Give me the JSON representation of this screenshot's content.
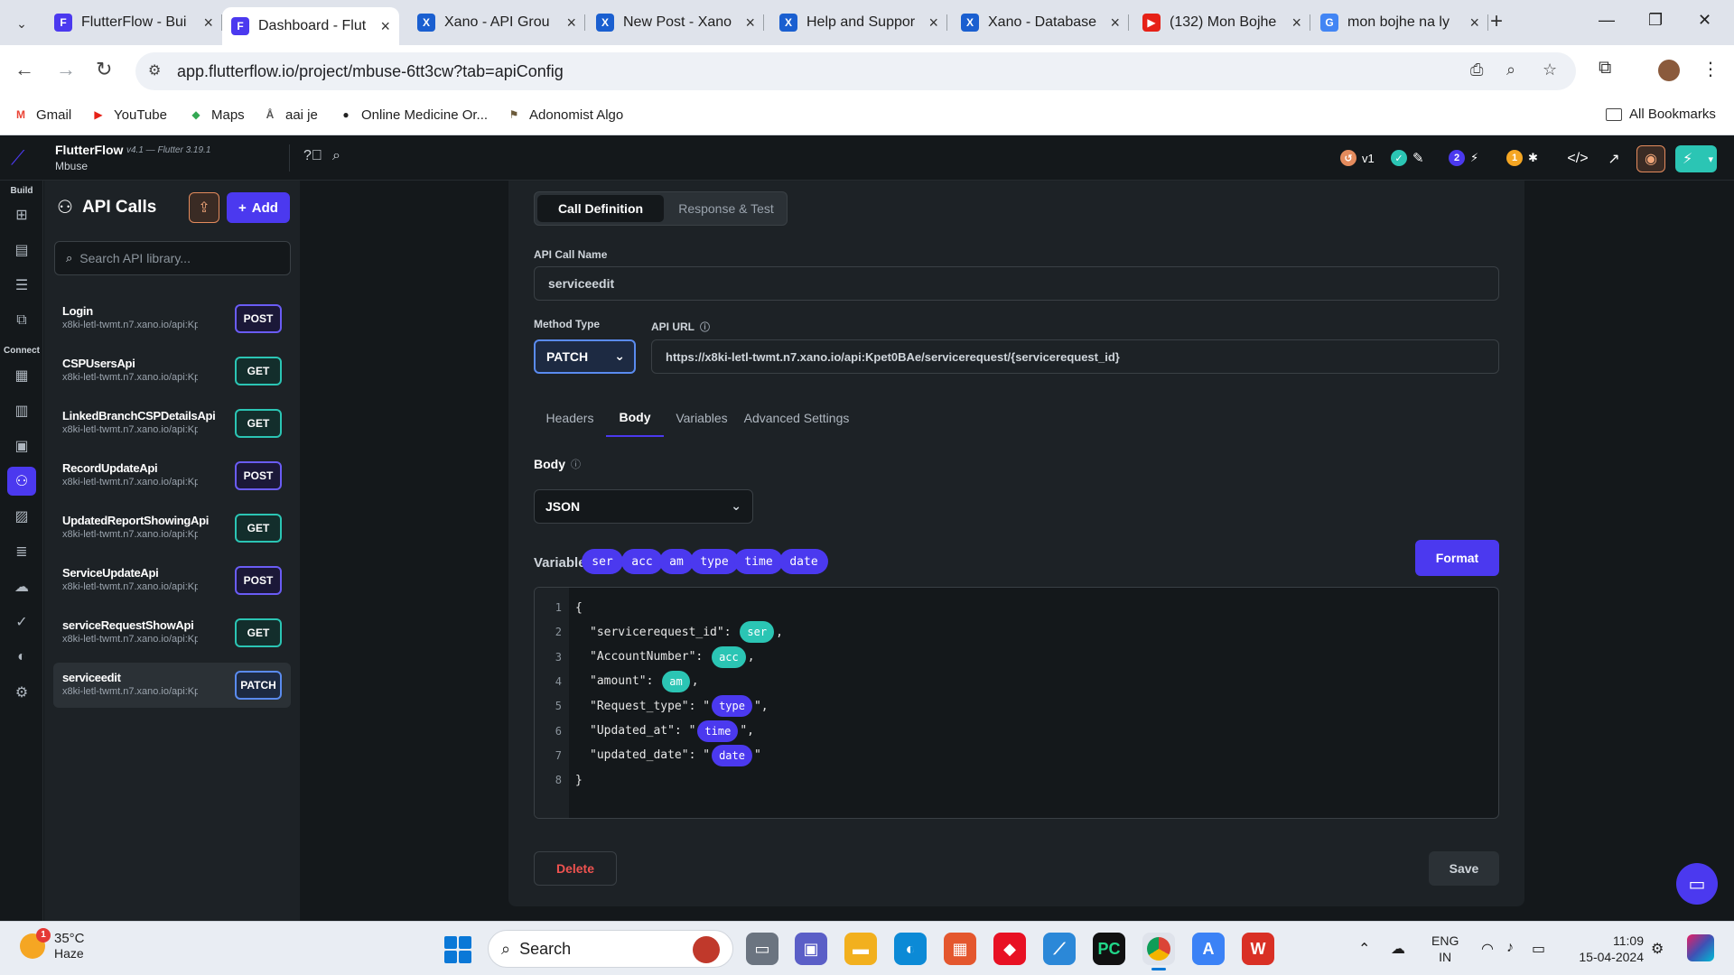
{
  "browser": {
    "tabs": [
      {
        "title": "FlutterFlow - Bui",
        "favicon": "flutterflow-icon",
        "color": "#4b39ef",
        "glyph": "F"
      },
      {
        "title": "Dashboard - Flut",
        "favicon": "flutterflow-icon",
        "color": "#4b39ef",
        "glyph": "F",
        "active": true
      },
      {
        "title": "Xano - API Grou",
        "favicon": "xano-icon",
        "color": "#1a5fd0",
        "glyph": "X"
      },
      {
        "title": "New Post - Xano",
        "favicon": "xano-icon",
        "color": "#1a5fd0",
        "glyph": "X"
      },
      {
        "title": "Help and Suppor",
        "favicon": "xano-icon",
        "color": "#1a5fd0",
        "glyph": "X"
      },
      {
        "title": "Xano - Database",
        "favicon": "xano-icon",
        "color": "#1a5fd0",
        "glyph": "X"
      },
      {
        "title": "(132) Mon Bojhe",
        "favicon": "youtube-icon",
        "color": "#e62117",
        "glyph": "▶"
      },
      {
        "title": "mon bojhe na ly",
        "favicon": "google-icon",
        "color": "#4285f4",
        "glyph": "G"
      }
    ],
    "url": "app.flutterflow.io/project/mbuse-6tt3cw?tab=apiConfig",
    "bookmarks": [
      {
        "label": "Gmail",
        "icon": "gmail-icon",
        "color": "#ea4335",
        "glyph": "M"
      },
      {
        "label": "YouTube",
        "icon": "youtube-icon",
        "color": "#e62117",
        "glyph": "▶"
      },
      {
        "label": "Maps",
        "icon": "maps-icon",
        "color": "#34a853",
        "glyph": "◆"
      },
      {
        "label": "aai je",
        "icon": "site-icon",
        "color": "#555555",
        "glyph": "Å"
      },
      {
        "label": "Online Medicine Or...",
        "icon": "globe-icon",
        "color": "#222222",
        "glyph": "●"
      },
      {
        "label": "Adonomist Algo",
        "icon": "site-icon",
        "color": "#6b5a3a",
        "glyph": "⚑"
      }
    ],
    "all_bookmarks": "All Bookmarks"
  },
  "app": {
    "name": "FlutterFlow",
    "version": "v4.1 — Flutter 3.19.1",
    "project": "Mbuse",
    "topbar": {
      "version_pill": "v1",
      "count_a": "2",
      "count_b": "1"
    },
    "rail": {
      "build_label": "Build",
      "connect_label": "Connect"
    },
    "side_panel": {
      "title": "API Calls",
      "add_label": "Add",
      "search_placeholder": "Search API library...",
      "items": [
        {
          "name": "Login",
          "url": "x8ki-letl-twmt.n7.xano.io/api:Kpet...",
          "method": "POST"
        },
        {
          "name": "CSPUsersApi",
          "url": "x8ki-letl-twmt.n7.xano.io/api:Kpet...",
          "method": "GET"
        },
        {
          "name": "LinkedBranchCSPDetailsApi",
          "url": "x8ki-letl-twmt.n7.xano.io/api:Kpet...",
          "method": "GET"
        },
        {
          "name": "RecordUpdateApi",
          "url": "x8ki-letl-twmt.n7.xano.io/api:Kpet...",
          "method": "POST"
        },
        {
          "name": "UpdatedReportShowingApi",
          "url": "x8ki-letl-twmt.n7.xano.io/api:Kpet...",
          "method": "GET"
        },
        {
          "name": "ServiceUpdateApi",
          "url": "x8ki-letl-twmt.n7.xano.io/api:Kpet...",
          "method": "POST"
        },
        {
          "name": "serviceRequestShowApi",
          "url": "x8ki-letl-twmt.n7.xano.io/api:Kpet...",
          "method": "GET"
        },
        {
          "name": "serviceedit",
          "url": "x8ki-letl-twmt.n7.xano.io/api:Kpet...",
          "method": "PATCH",
          "selected": true
        }
      ]
    },
    "editor": {
      "tabs": {
        "call_definition": "Call Definition",
        "response_test": "Response & Test"
      },
      "api_call_name_label": "API Call Name",
      "api_call_name": "serviceedit",
      "method_type_label": "Method Type",
      "method": "PATCH",
      "api_url_label": "API URL",
      "api_url": "https://x8ki-letl-twmt.n7.xano.io/api:Kpet0BAe/servicerequest/{servicerequest_id}",
      "sub_tabs": [
        "Headers",
        "Body",
        "Variables",
        "Advanced Settings"
      ],
      "active_sub_tab": "Body",
      "body_label": "Body",
      "body_type": "JSON",
      "variables_label": "Variables:",
      "variables": [
        "ser",
        "acc",
        "am",
        "type",
        "time",
        "date"
      ],
      "format_label": "Format",
      "code_lines": [
        {
          "n": "1",
          "text": "{"
        },
        {
          "n": "2",
          "key": "\"servicerequest_id\": ",
          "var": "ser",
          "color": "teal",
          "quoted": false
        },
        {
          "n": "3",
          "key": "\"AccountNumber\": ",
          "var": "acc",
          "color": "teal",
          "quoted": false
        },
        {
          "n": "4",
          "key": "\"amount\": ",
          "var": "am",
          "color": "teal",
          "quoted": false
        },
        {
          "n": "5",
          "key": "\"Request_type\": ",
          "var": "type",
          "color": "blue",
          "quoted": true
        },
        {
          "n": "6",
          "key": "\"Updated_at\": ",
          "var": "time",
          "color": "blue",
          "quoted": true
        },
        {
          "n": "7",
          "key": "\"updated_date\": ",
          "var": "date",
          "color": "blue",
          "quoted": true,
          "last": true
        },
        {
          "n": "8",
          "text": "}"
        }
      ],
      "delete_label": "Delete",
      "save_label": "Save"
    }
  },
  "taskbar": {
    "temperature": "35°C",
    "condition": "Haze",
    "weather_badge": "1",
    "search_label": "Search",
    "lang_line1": "ENG",
    "lang_line2": "IN",
    "time": "11:09",
    "date": "15-04-2024"
  }
}
